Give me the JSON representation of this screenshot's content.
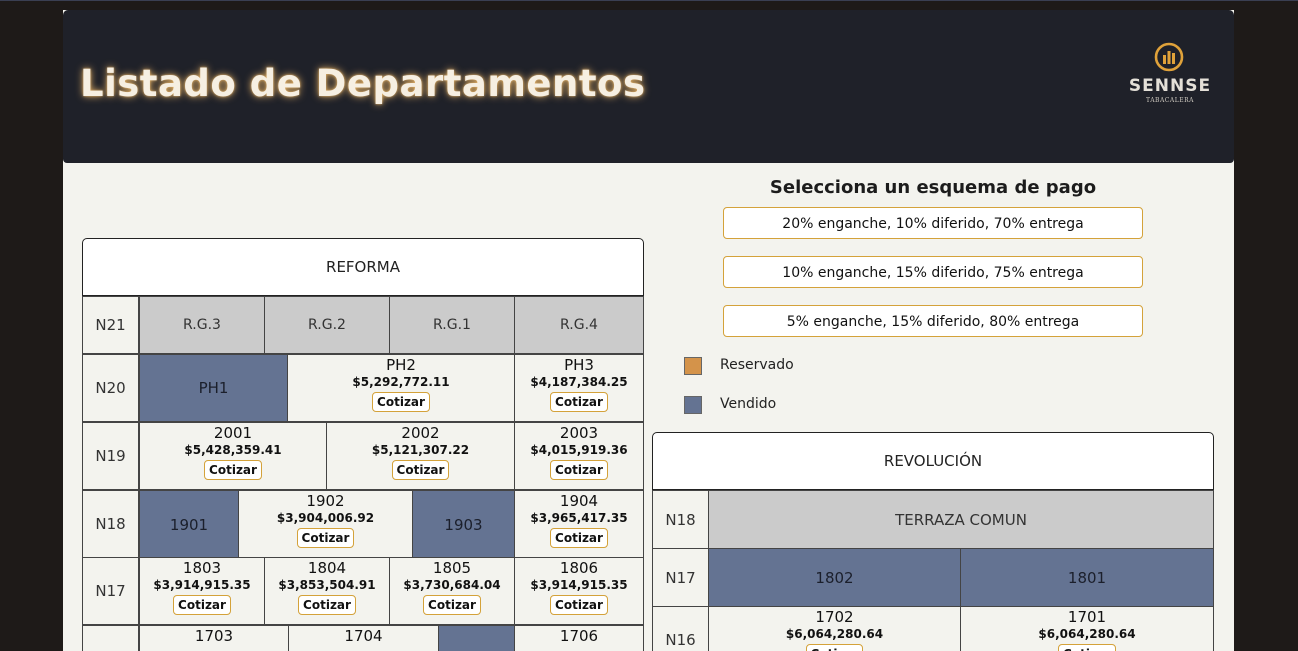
{
  "header": {
    "title": "Listado de Departamentos",
    "logo_name": "SENNSE",
    "logo_sub": "TABACALERA"
  },
  "payment": {
    "title": "Selecciona un esquema de pago",
    "options": [
      "20% enganche, 10% diferido, 70% entrega",
      "10% enganche, 15% diferido, 75% entrega",
      "5% enganche, 15% diferido, 80% entrega"
    ]
  },
  "legend": [
    {
      "label": "Reservado",
      "color": "#d4934a"
    },
    {
      "label": "Vendido",
      "color": "#647392"
    }
  ],
  "cotizar_label": "Cotizar",
  "reforma": {
    "title": "REFORMA",
    "rows": [
      {
        "label": "N21",
        "units": [
          {
            "name": "R.G.3",
            "status": "common"
          },
          {
            "name": "R.G.2",
            "status": "common"
          },
          {
            "name": "R.G.1",
            "status": "common"
          },
          {
            "name": "R.G.4",
            "status": "common"
          }
        ]
      },
      {
        "label": "N20",
        "units": [
          {
            "name": "PH1",
            "status": "sold"
          },
          {
            "name": "PH2",
            "status": "available",
            "price": "$5,292,772.11"
          },
          {
            "name": "PH3",
            "status": "available",
            "price": "$4,187,384.25"
          }
        ]
      },
      {
        "label": "N19",
        "units": [
          {
            "name": "2001",
            "status": "available",
            "price": "$5,428,359.41"
          },
          {
            "name": "2002",
            "status": "available",
            "price": "$5,121,307.22"
          },
          {
            "name": "2003",
            "status": "available",
            "price": "$4,015,919.36"
          }
        ]
      },
      {
        "label": "N18",
        "units": [
          {
            "name": "1901",
            "status": "sold"
          },
          {
            "name": "1902",
            "status": "available",
            "price": "$3,904,006.92"
          },
          {
            "name": "1903",
            "status": "sold"
          },
          {
            "name": "1904",
            "status": "available",
            "price": "$3,965,417.35"
          }
        ]
      },
      {
        "label": "N17",
        "units": [
          {
            "name": "1803",
            "status": "available",
            "price": "$3,914,915.35"
          },
          {
            "name": "1804",
            "status": "available",
            "price": "$3,853,504.91"
          },
          {
            "name": "1805",
            "status": "available",
            "price": "$3,730,684.04"
          },
          {
            "name": "1806",
            "status": "available",
            "price": "$3,914,915.35"
          }
        ]
      },
      {
        "label": "",
        "units": [
          {
            "name": "1703",
            "status": "available"
          },
          {
            "name": "1704",
            "status": "available"
          },
          {
            "name": "",
            "status": "sold"
          },
          {
            "name": "1706",
            "status": "available"
          }
        ]
      }
    ]
  },
  "revolucion": {
    "title": "REVOLUCIÓN",
    "rows": [
      {
        "label": "N18",
        "units": [
          {
            "name": "TERRAZA COMUN",
            "status": "common"
          }
        ]
      },
      {
        "label": "N17",
        "units": [
          {
            "name": "1802",
            "status": "sold"
          },
          {
            "name": "1801",
            "status": "sold"
          }
        ]
      },
      {
        "label": "N16",
        "units": [
          {
            "name": "1702",
            "status": "available",
            "price": "$6,064,280.64"
          },
          {
            "name": "1701",
            "status": "available",
            "price": "$6,064,280.64"
          }
        ]
      }
    ]
  }
}
